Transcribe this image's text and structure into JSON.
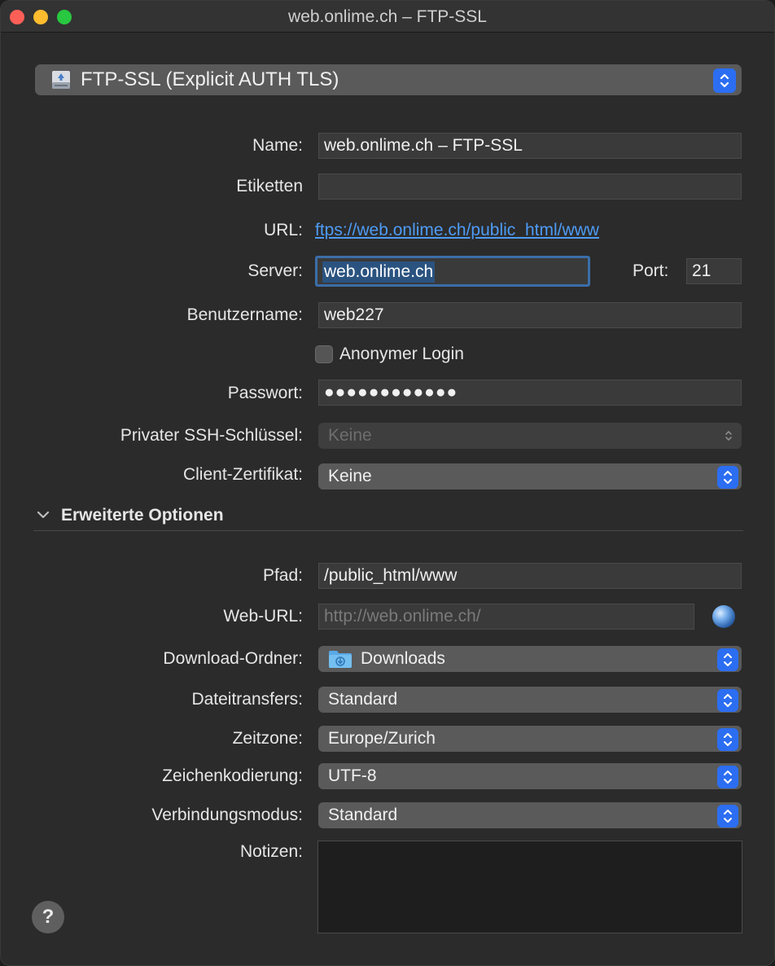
{
  "window": {
    "title": "web.onlime.ch – FTP-SSL"
  },
  "protocol": {
    "label": "FTP-SSL (Explicit AUTH TLS)"
  },
  "form": {
    "name_label": "Name:",
    "name_value": "web.onlime.ch – FTP-SSL",
    "tags_label": "Etiketten",
    "tags_value": "",
    "url_label": "URL:",
    "url_value": "ftps://web.onlime.ch/public_html/www",
    "server_label": "Server:",
    "server_value": "web.onlime.ch",
    "port_label": "Port:",
    "port_value": "21",
    "username_label": "Benutzername:",
    "username_value": "web227",
    "anonymous_label": "Anonymer Login",
    "anonymous_checked": false,
    "password_label": "Passwort:",
    "password_value": "●●●●●●●●●●●●",
    "ssh_key_label": "Privater SSH-Schlüssel:",
    "ssh_key_value": "Keine",
    "client_cert_label": "Client-Zertifikat:",
    "client_cert_value": "Keine"
  },
  "advanced": {
    "section_title": "Erweiterte Optionen",
    "path_label": "Pfad:",
    "path_value": "/public_html/www",
    "web_url_label": "Web-URL:",
    "web_url_placeholder": "http://web.onlime.ch/",
    "download_folder_label": "Download-Ordner:",
    "download_folder_value": "Downloads",
    "transfers_label": "Dateitransfers:",
    "transfers_value": "Standard",
    "timezone_label": "Zeitzone:",
    "timezone_value": "Europe/Zurich",
    "encoding_label": "Zeichenkodierung:",
    "encoding_value": "UTF-8",
    "connection_mode_label": "Verbindungsmodus:",
    "connection_mode_value": "Standard",
    "notes_label": "Notizen:",
    "notes_value": ""
  },
  "help": {
    "label": "?"
  },
  "icons": {
    "protocol": "drive-icon",
    "stepper": "up-down-chevron-icon",
    "disclosure": "chevron-down-icon",
    "web_url": "globe-icon",
    "download_folder": "downloads-folder-icon"
  },
  "colors": {
    "accent": "#2c6ef2",
    "link": "#4d9bf5",
    "focus_ring": "#3b6ea8",
    "close": "#ff5f57",
    "minimize": "#febc2e",
    "maximize": "#28c840"
  }
}
